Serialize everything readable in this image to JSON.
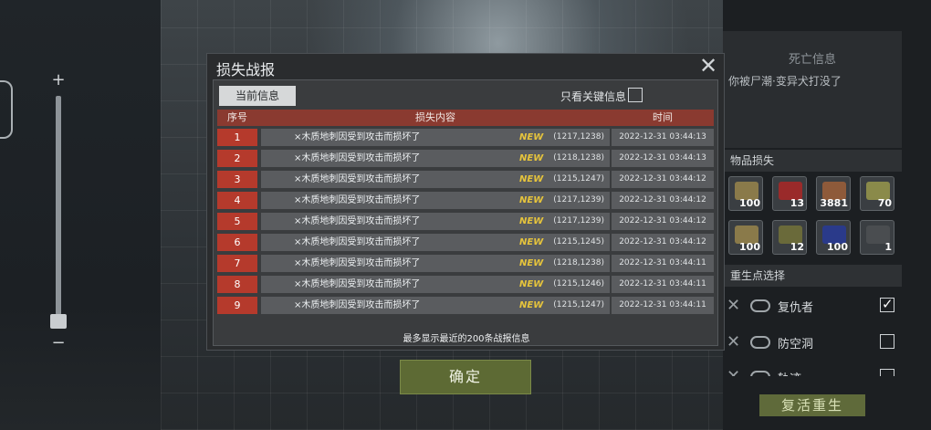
{
  "dialog": {
    "title": "损失战报",
    "tab_current": "当前信息",
    "filter_label": "只看关键信息",
    "headers": {
      "index": "序号",
      "content": "损失内容",
      "time": "时间"
    },
    "rows": [
      {
        "index": "1",
        "text": "×木质地刺因受到攻击而损坏了",
        "badge": "NEW",
        "coord": "(1217,1238)",
        "time": "2022-12-31 03:44:13"
      },
      {
        "index": "2",
        "text": "×木质地刺因受到攻击而损坏了",
        "badge": "NEW",
        "coord": "(1218,1238)",
        "time": "2022-12-31 03:44:13"
      },
      {
        "index": "3",
        "text": "×木质地刺因受到攻击而损坏了",
        "badge": "NEW",
        "coord": "(1215,1247)",
        "time": "2022-12-31 03:44:12"
      },
      {
        "index": "4",
        "text": "×木质地刺因受到攻击而损坏了",
        "badge": "NEW",
        "coord": "(1217,1239)",
        "time": "2022-12-31 03:44:12"
      },
      {
        "index": "5",
        "text": "×木质地刺因受到攻击而损坏了",
        "badge": "NEW",
        "coord": "(1217,1239)",
        "time": "2022-12-31 03:44:12"
      },
      {
        "index": "6",
        "text": "×木质地刺因受到攻击而损坏了",
        "badge": "NEW",
        "coord": "(1215,1245)",
        "time": "2022-12-31 03:44:12"
      },
      {
        "index": "7",
        "text": "×木质地刺因受到攻击而损坏了",
        "badge": "NEW",
        "coord": "(1218,1238)",
        "time": "2022-12-31 03:44:11"
      },
      {
        "index": "8",
        "text": "×木质地刺因受到攻击而损坏了",
        "badge": "NEW",
        "coord": "(1215,1246)",
        "time": "2022-12-31 03:44:11"
      },
      {
        "index": "9",
        "text": "×木质地刺因受到攻击而损坏了",
        "badge": "NEW",
        "coord": "(1215,1247)",
        "time": "2022-12-31 03:44:11"
      }
    ],
    "footer_note": "最多显示最近的200条战报信息",
    "confirm_label": "确定"
  },
  "right_panel": {
    "death_title": "死亡信息",
    "death_text": "你被尸潮·变异犬打没了",
    "items_title": "物品损失",
    "items": [
      {
        "icon": "wood-planks-icon",
        "count": "100",
        "color": "#8a7a4a"
      },
      {
        "icon": "red-cloth-icon",
        "count": "13",
        "color": "#9a2a2a"
      },
      {
        "icon": "logs-icon",
        "count": "3881",
        "color": "#8e5a3a"
      },
      {
        "icon": "bamboo-icon",
        "count": "70",
        "color": "#8a8a4a"
      },
      {
        "icon": "wood-planks-icon",
        "count": "100",
        "color": "#8a7a4a"
      },
      {
        "icon": "ammo-icon",
        "count": "12",
        "color": "#6a6a3a"
      },
      {
        "icon": "blue-cloth-icon",
        "count": "100",
        "color": "#2a3a8a"
      },
      {
        "icon": "rifle-icon",
        "count": "1",
        "color": "#4a4d50"
      }
    ],
    "spawn_title": "重生点选择",
    "spawn_options": [
      {
        "label": "复仇者",
        "checked": "✓"
      },
      {
        "label": "防空洞",
        "checked": ""
      },
      {
        "label": "轨迹",
        "checked": ""
      }
    ],
    "revive_label": "复活重生"
  },
  "map_controls": {
    "zoom_in": "+",
    "zoom_out": "−"
  },
  "colors": {
    "header_red": "#8a3a30",
    "index_red": "#b53a2c",
    "new_badge": "#e6c43c",
    "confirm_green": "#5d6a34"
  }
}
